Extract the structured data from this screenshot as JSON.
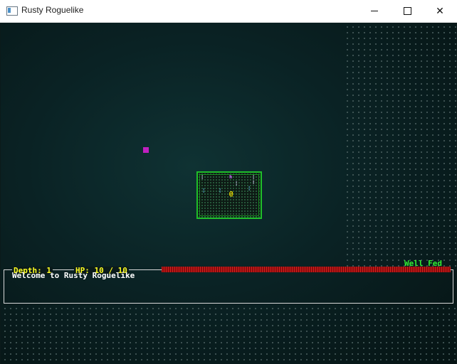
{
  "window": {
    "title": "Rusty Roguelike",
    "controls": [
      "minimize",
      "maximize",
      "close"
    ]
  },
  "hud": {
    "depth": "Depth: 1",
    "hp_text": "HP: 10 / 10",
    "hp_fraction": 1.0,
    "hunger_status": "Well Fed",
    "log": [
      "Welcome to Rusty Roguelike"
    ]
  },
  "map": {
    "player_glyph": "@",
    "entity_glyphs": [
      "¦",
      "h",
      "¦",
      "¦",
      "¦",
      "¦",
      "¦",
      "!"
    ],
    "colors": {
      "wall": "#1fbf2a",
      "player": "#ffee00",
      "hp_bar": "#b01010",
      "hud_text": "#ffff22",
      "hunger_text": "#33ee33"
    }
  }
}
